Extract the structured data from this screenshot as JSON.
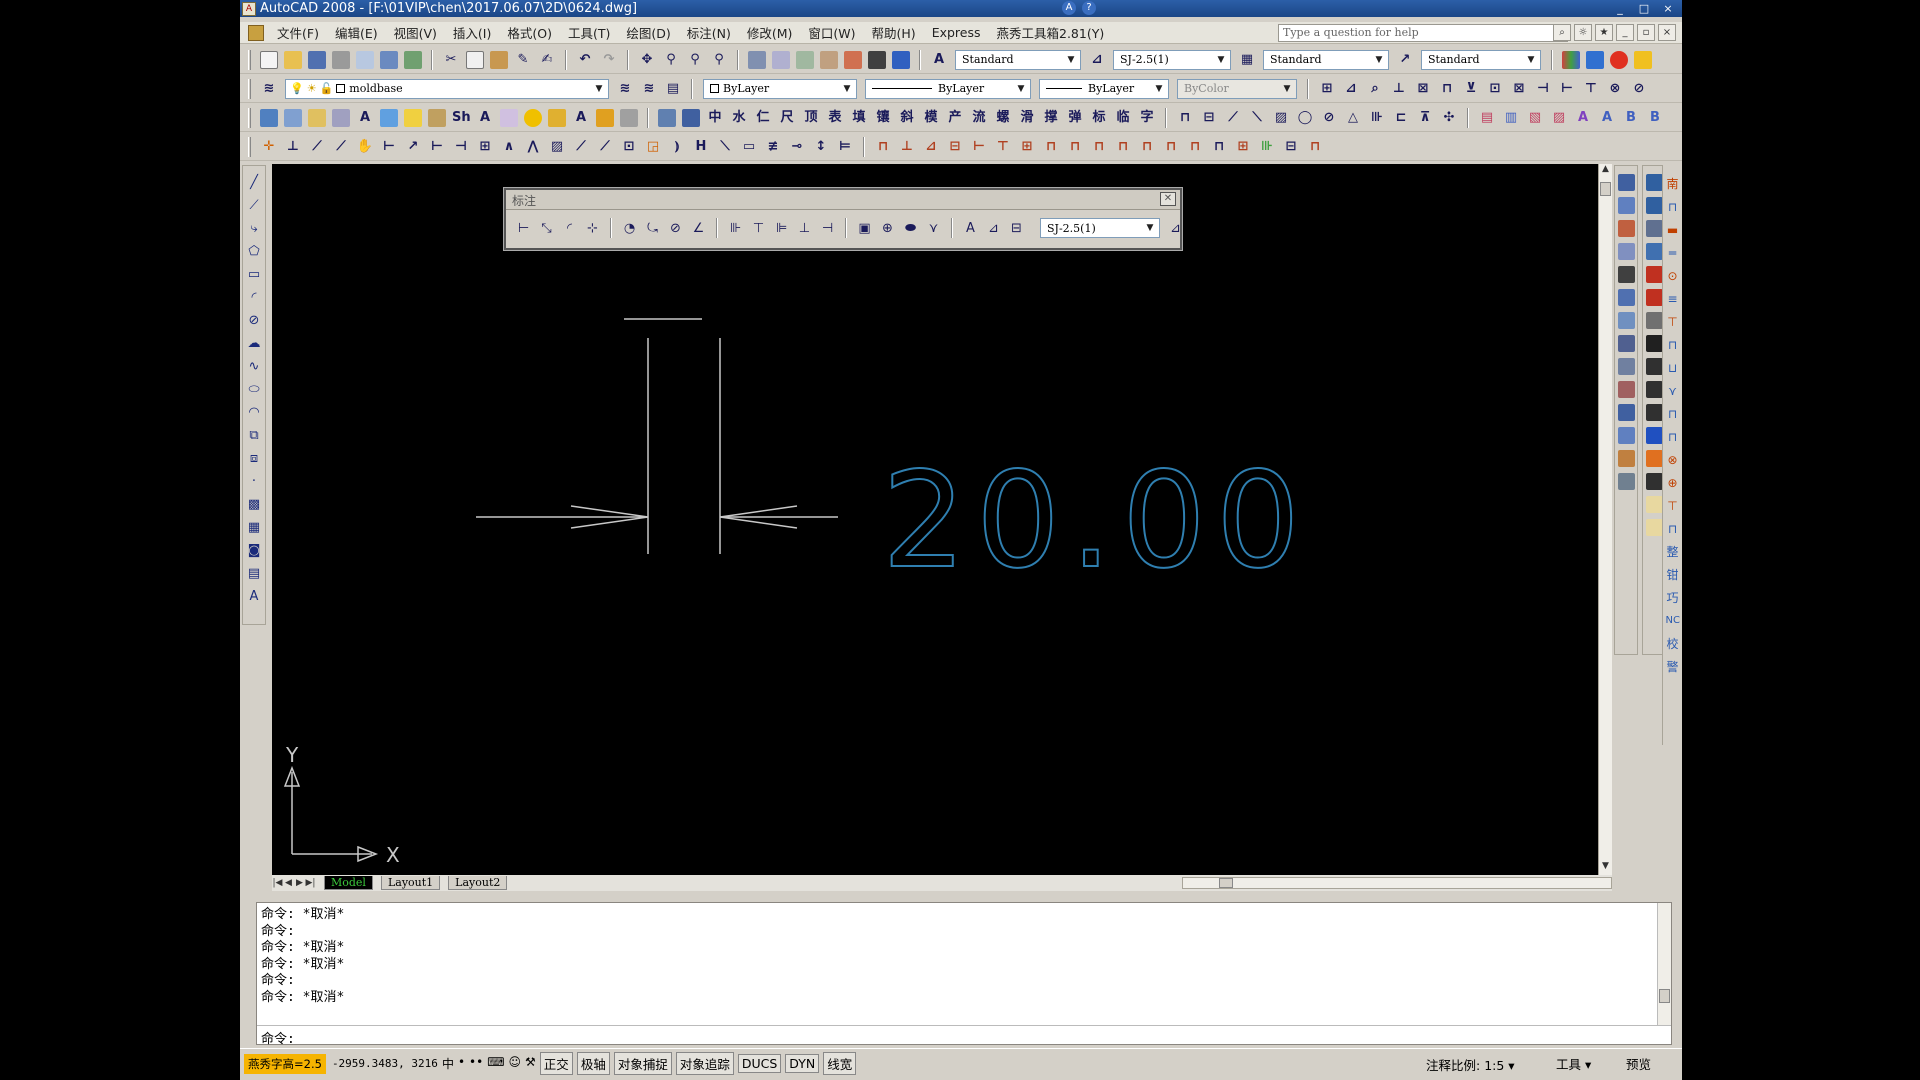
{
  "window": {
    "title": "AutoCAD 2008 - [F:\\01VIP\\chen\\2017.06.07\\2D\\0624.dwg]",
    "controls": [
      "_",
      "□",
      "×"
    ]
  },
  "menu": {
    "items": [
      "文件(F)",
      "编辑(E)",
      "视图(V)",
      "插入(I)",
      "格式(O)",
      "工具(T)",
      "绘图(D)",
      "标注(N)",
      "修改(M)",
      "窗口(W)",
      "帮助(H)",
      "Express",
      "燕秀工具箱2.81(Y)"
    ],
    "help_placeholder": "Type a question for help"
  },
  "toolbar1": {
    "text_style": "Standard",
    "dim_style": "SJ-2.5(1)",
    "table_style": "Standard",
    "mleader_style": "Standard"
  },
  "toolbar2": {
    "layer": "moldbase",
    "color": "ByLayer",
    "linetype": "ByLayer",
    "lineweight": "ByLayer",
    "plotstyle": "ByColor"
  },
  "toolbar3": {
    "glyphs": [
      "中",
      "水",
      "仁",
      "尺",
      "顶",
      "表",
      "填",
      "镶",
      "斜",
      "模",
      "产",
      "流",
      "螺",
      "滑",
      "撑",
      "弹",
      "标",
      "临",
      "字"
    ]
  },
  "dim_toolbar": {
    "title": "标注",
    "style": "SJ-2.5(1)"
  },
  "drawing": {
    "dimension_text": "20.00",
    "ucs_x": "X",
    "ucs_y": "Y",
    "line_color": "#c8c8c8",
    "text_color": "#2f7fb0"
  },
  "layout_tabs": [
    "Model",
    "Layout1",
    "Layout2"
  ],
  "command_history": [
    "命令: *取消*",
    "命令:",
    "命令: *取消*",
    "命令: *取消*",
    "命令:",
    "命令: *取消*"
  ],
  "command_prompt": "命令:",
  "status": {
    "font_height": "燕秀字高=2.5",
    "coords": "-2959.3483, 3216",
    "ime": [
      "中",
      "•",
      "••"
    ],
    "modes": [
      "正交",
      "极轴",
      "对象捕捉",
      "对象追踪",
      "DUCS",
      "DYN",
      "线宽"
    ],
    "annotation_scale_label": "注释比例:",
    "annotation_scale": "1:5",
    "tools_label": "工具",
    "preview_label": "预览"
  },
  "right_edge_glyphs": [
    "南",
    "整",
    "钳",
    "巧",
    "NC",
    "校",
    "警"
  ]
}
